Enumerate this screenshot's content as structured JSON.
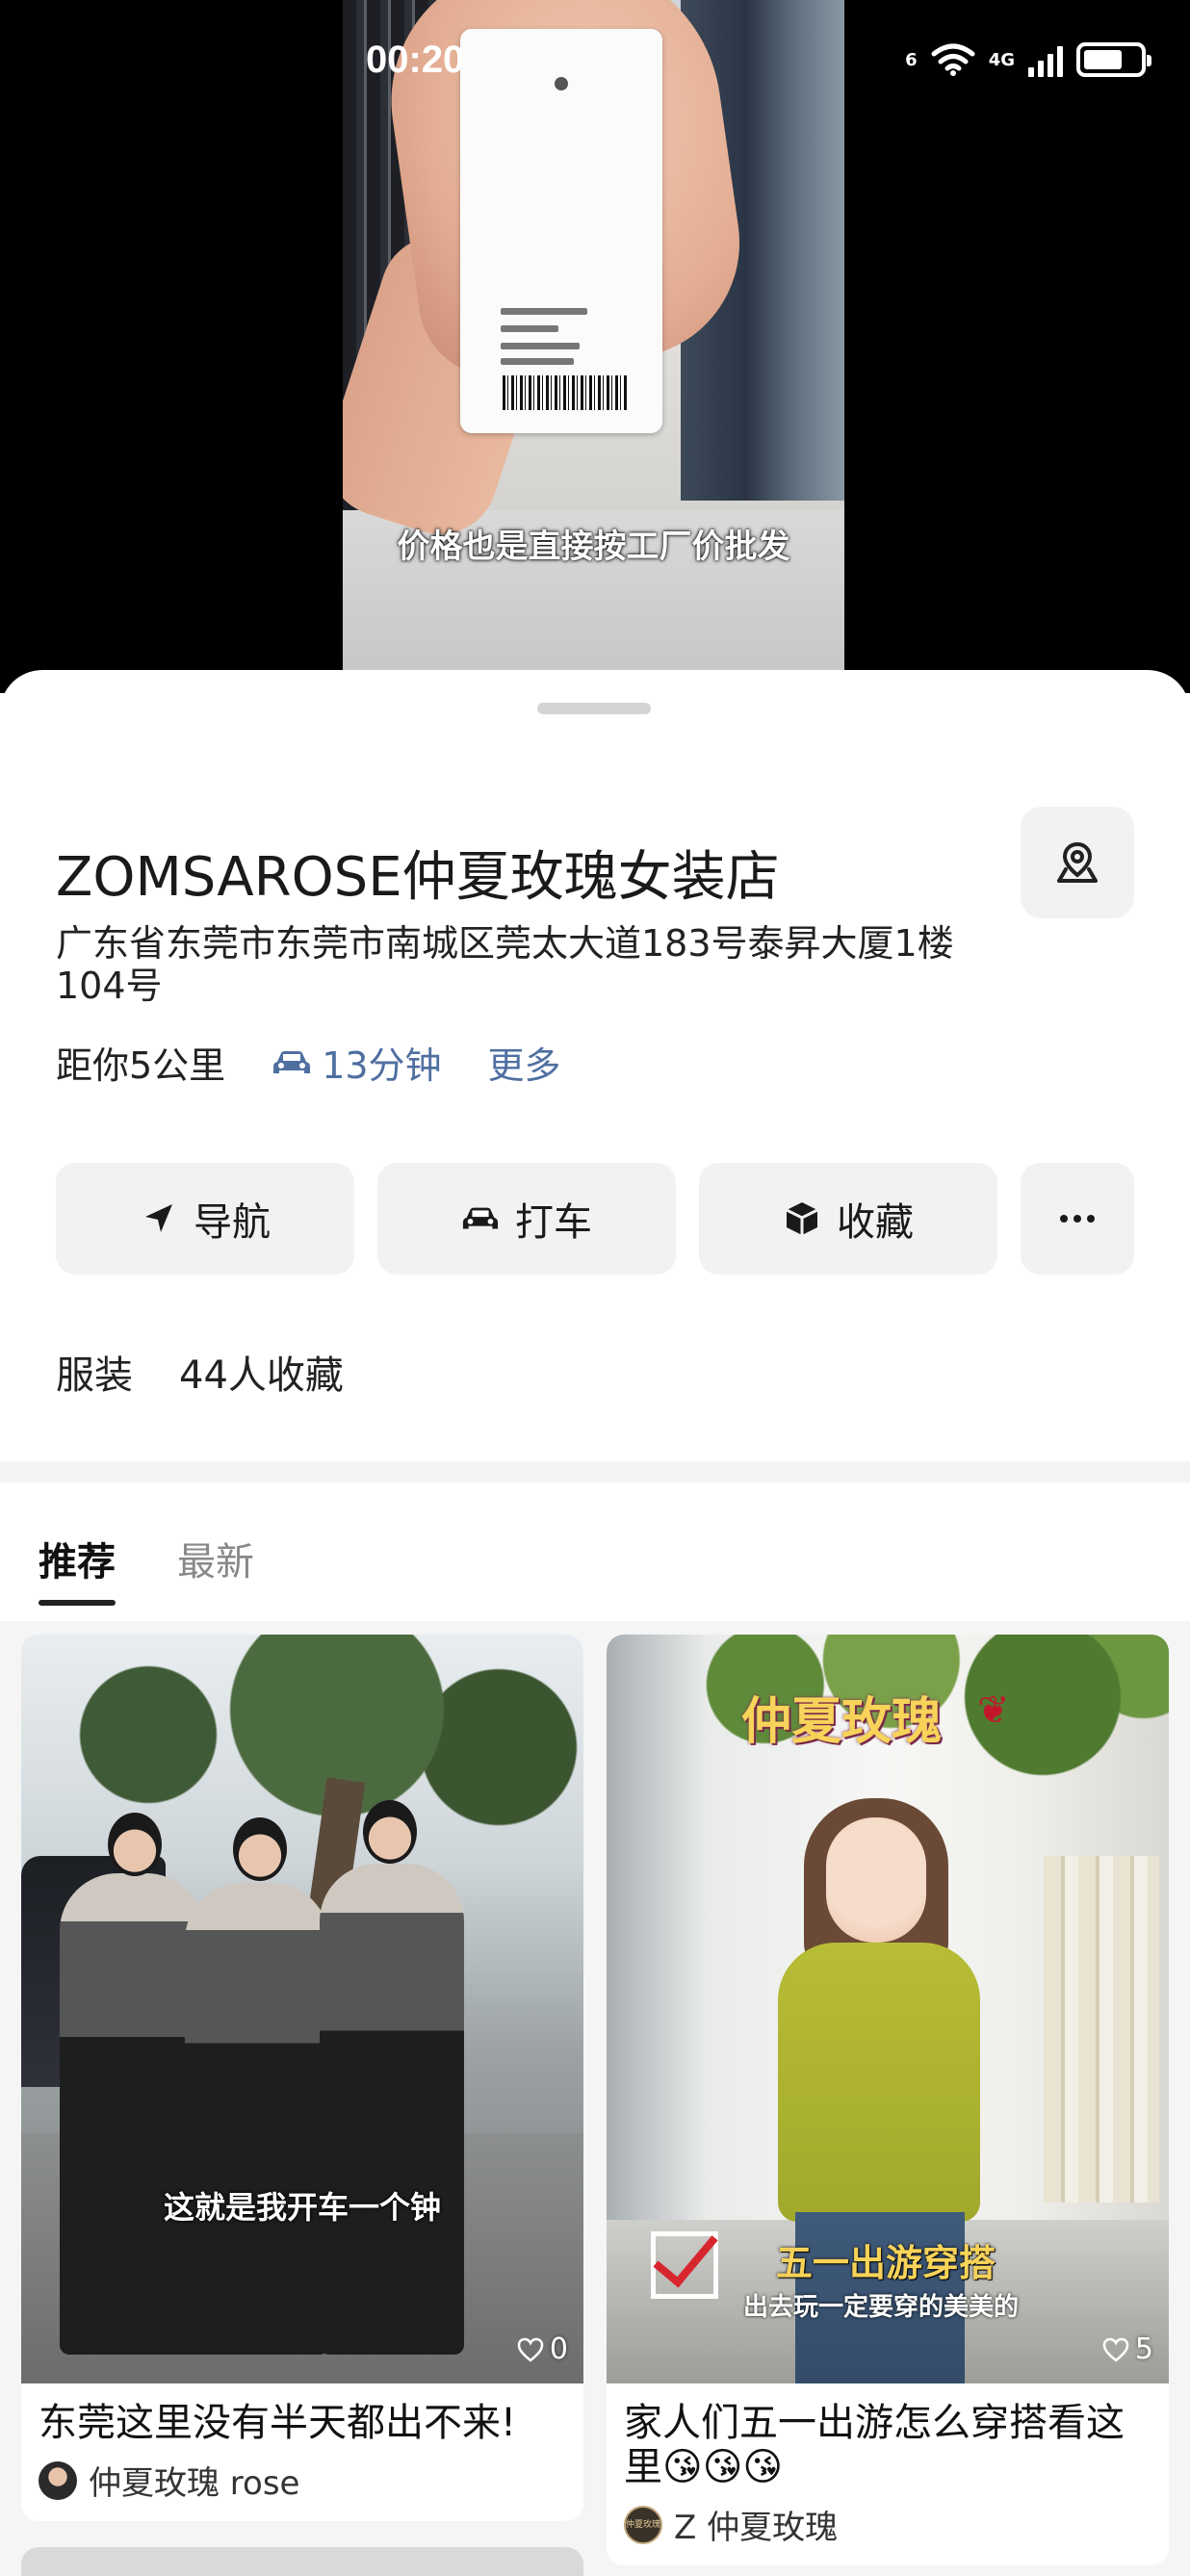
{
  "status_bar": {
    "time": "00:20",
    "network": "4G",
    "wifi_badge": "6"
  },
  "video": {
    "subtitle": "价格也是直接按工厂价批发"
  },
  "shop": {
    "name": "ZOMSAROSE仲夏玫瑰女装店",
    "address": "广东省东莞市东莞市南城区莞太大道183号泰昇大厦1楼104号",
    "distance": "距你5公里",
    "drive_time": "13分钟",
    "more_label": "更多",
    "map_icon": "map-pin-icon",
    "category": "服装",
    "favorites": "44人收藏"
  },
  "actions": {
    "navigate": "导航",
    "taxi": "打车",
    "collect": "收藏",
    "more_icon": "more-dots-icon"
  },
  "tabs": [
    {
      "label": "推荐",
      "active": true
    },
    {
      "label": "最新",
      "active": false
    }
  ],
  "posts": [
    {
      "overlay_text": "这就是我开车一个钟",
      "likes": "0",
      "title": "东莞这里没有半天都出不来!",
      "author": "仲夏玫瑰 rose"
    },
    {
      "brand_text": "仲夏玫瑰",
      "overlay_text": "五一出游穿搭",
      "overlay_subtext": "出去玩一定要穿的美美的",
      "likes": "5",
      "title": "家人们五一出游怎么穿搭看这里😘😘😘",
      "author": "Z 仲夏玫瑰",
      "avatar_text": "仲夏玫瑰"
    }
  ],
  "colors": {
    "accent_link": "#4f6fa0",
    "button_bg": "#f2f2f2",
    "text_primary": "#1a1a1a"
  }
}
